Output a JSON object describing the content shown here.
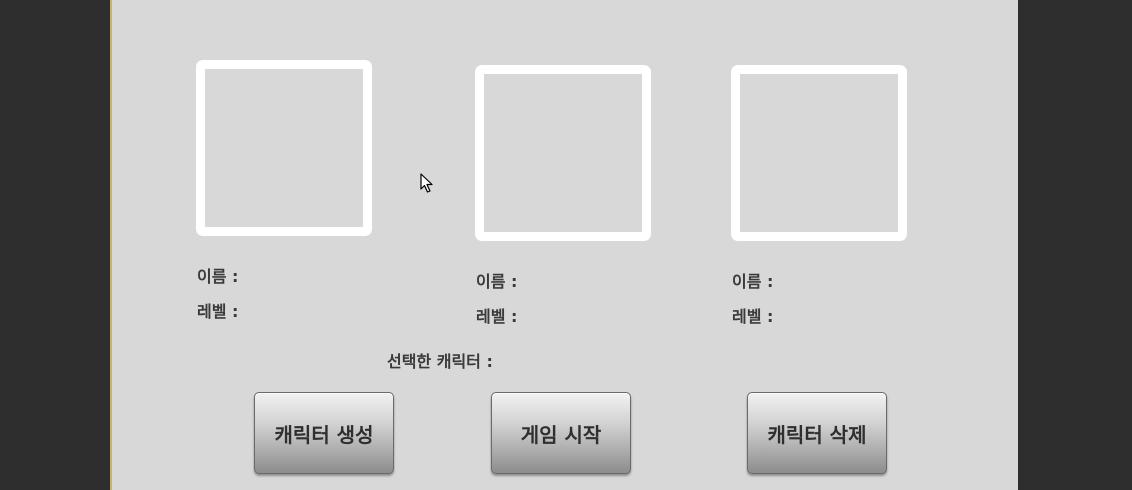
{
  "slots": [
    {
      "name_label": "이름 :",
      "level_label": "레벨 :"
    },
    {
      "name_label": "이름 :",
      "level_label": "레벨 :"
    },
    {
      "name_label": "이름 :",
      "level_label": "레벨 :"
    }
  ],
  "selected_label": "선택한 캐릭터 :",
  "buttons": {
    "create": "캐릭터 생성",
    "start": "게임 시작",
    "delete": "캐릭터 삭제"
  },
  "colors": {
    "background": "#2e2e2e",
    "panel": "#d8d8d8",
    "slot_border": "#ffffff",
    "text": "#3a3a3a"
  },
  "icons": {
    "cursor": "mouse-pointer-icon"
  }
}
